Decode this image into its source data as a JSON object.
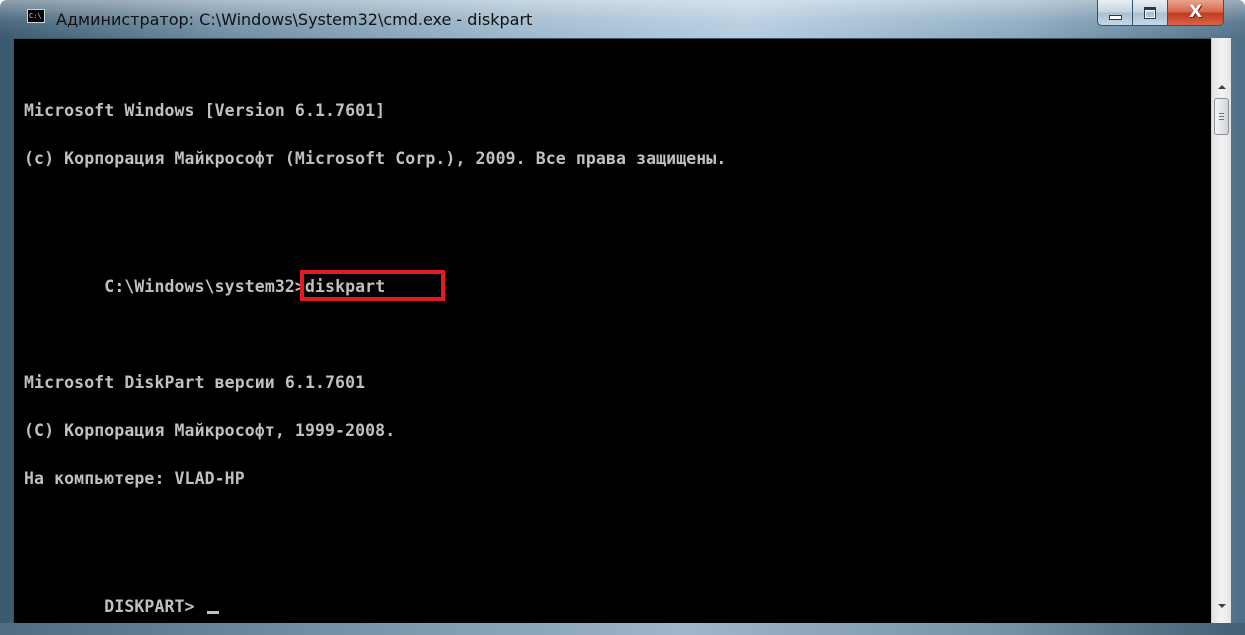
{
  "window": {
    "title": "Администратор: C:\\Windows\\System32\\cmd.exe - diskpart",
    "app_icon_text": "C:\\",
    "controls": {
      "minimize": "minimize",
      "maximize": "maximize",
      "close": "X"
    }
  },
  "console": {
    "lines": [
      "Microsoft Windows [Version 6.1.7601]",
      "(c) Корпорация Майкрософт (Microsoft Corp.), 2009. Все права защищены.",
      "",
      "",
      "",
      "Microsoft DiskPart версии 6.1.7601",
      "(C) Корпорация Майкрософт, 1999-2008.",
      "На компьютере: VLAD-HP",
      ""
    ],
    "prompt_path": "C:\\Windows\\system32>",
    "highlighted_command": "diskpart",
    "current_prompt": "DISKPART> ",
    "highlight_color": "#e31b23",
    "text_color": "#c0c0c0",
    "background_color": "#000000"
  },
  "scrollbar": {
    "up_icon": "scroll-up-arrow",
    "down_icon": "scroll-down-arrow"
  }
}
